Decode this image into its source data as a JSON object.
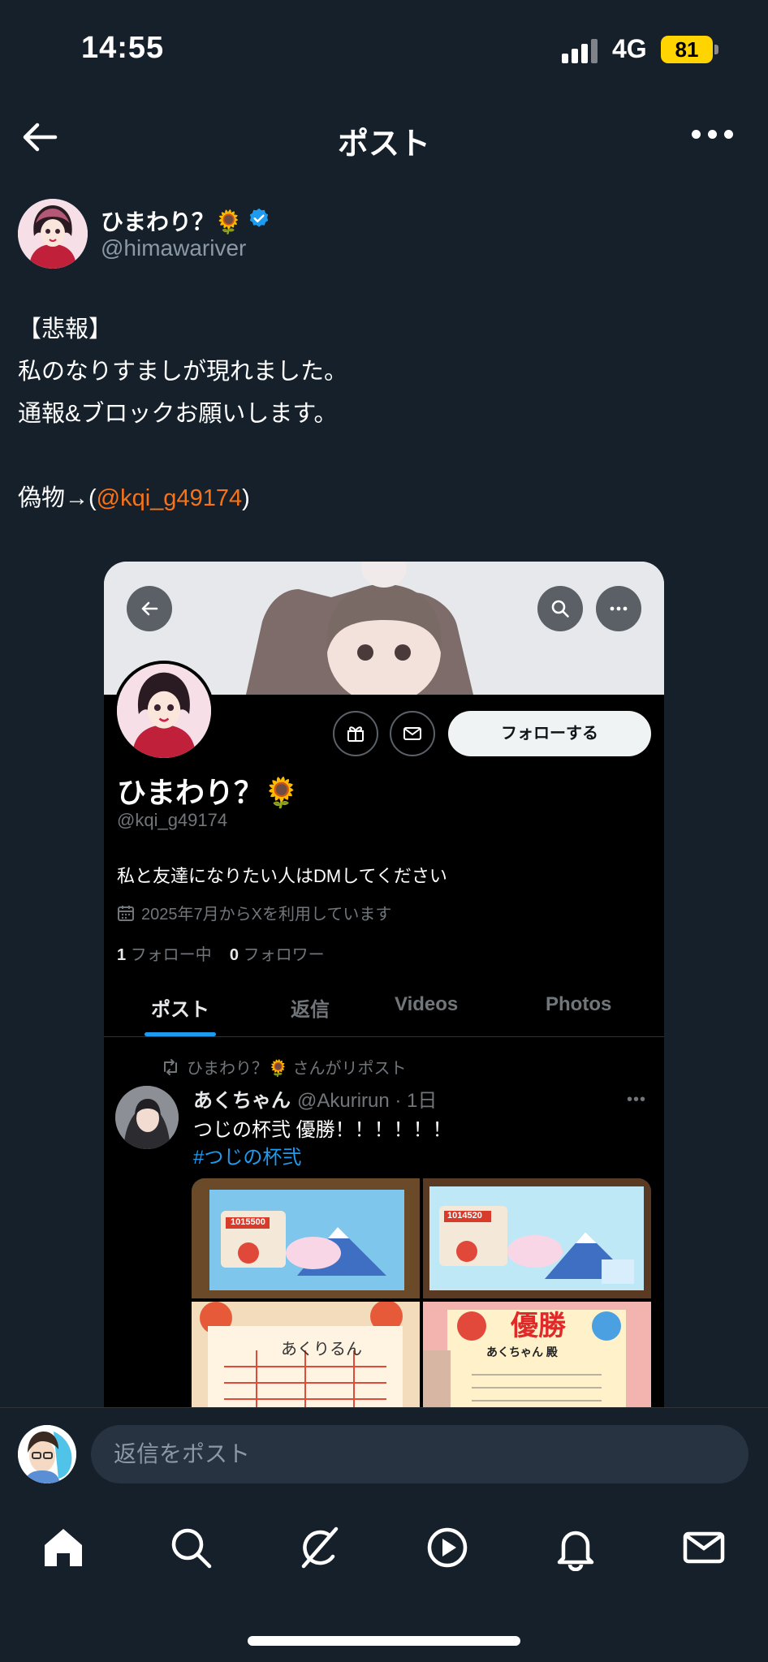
{
  "status_bar": {
    "time": "14:55",
    "network": "4G",
    "battery": "81"
  },
  "header": {
    "title": "ポスト"
  },
  "author": {
    "name": "ひまわり？🌻",
    "handle": "@himawariver"
  },
  "post": {
    "lines": [
      "【悲報】",
      "私のなりすましが現れました。",
      "通報&ブロックお願いします。",
      "",
      "偽物→("
    ],
    "mention": "@kqi_g49174",
    "close": ")"
  },
  "embed": {
    "follow_button": "フォローする",
    "name": "ひまわり？🌻",
    "handle": "@kqi_g49174",
    "bio": "私と友達になりたい人はDMしてください",
    "joined": "2025年7月からXを利用しています",
    "following_count": "1",
    "following_label": "フォロー中",
    "followers_count": "0",
    "followers_label": "フォロワー",
    "tabs": [
      "ポスト",
      "返信",
      "Videos",
      "Photos"
    ],
    "repost_label": "ひまわり？🌻 さんがリポスト",
    "tweet": {
      "name": "あくちゃん",
      "meta": "@Akurirun · 1日",
      "text": "つじの杯弐 優勝！！！！！！",
      "hashtag": "#つじの杯弐",
      "photo_texts": [
        "1015500",
        "1014520",
        "あくりるん",
        "優勝",
        "あくちゃん 殿"
      ]
    }
  },
  "reply": {
    "placeholder": "返信をポスト"
  },
  "nav": {
    "icons": [
      "home-icon",
      "search-icon",
      "grok-icon",
      "video-icon",
      "bell-icon",
      "mail-icon"
    ]
  },
  "colors": {
    "background": "#15202b",
    "accent": "#1d9bf0",
    "mention": "#f97316",
    "battery": "#ffd400"
  }
}
